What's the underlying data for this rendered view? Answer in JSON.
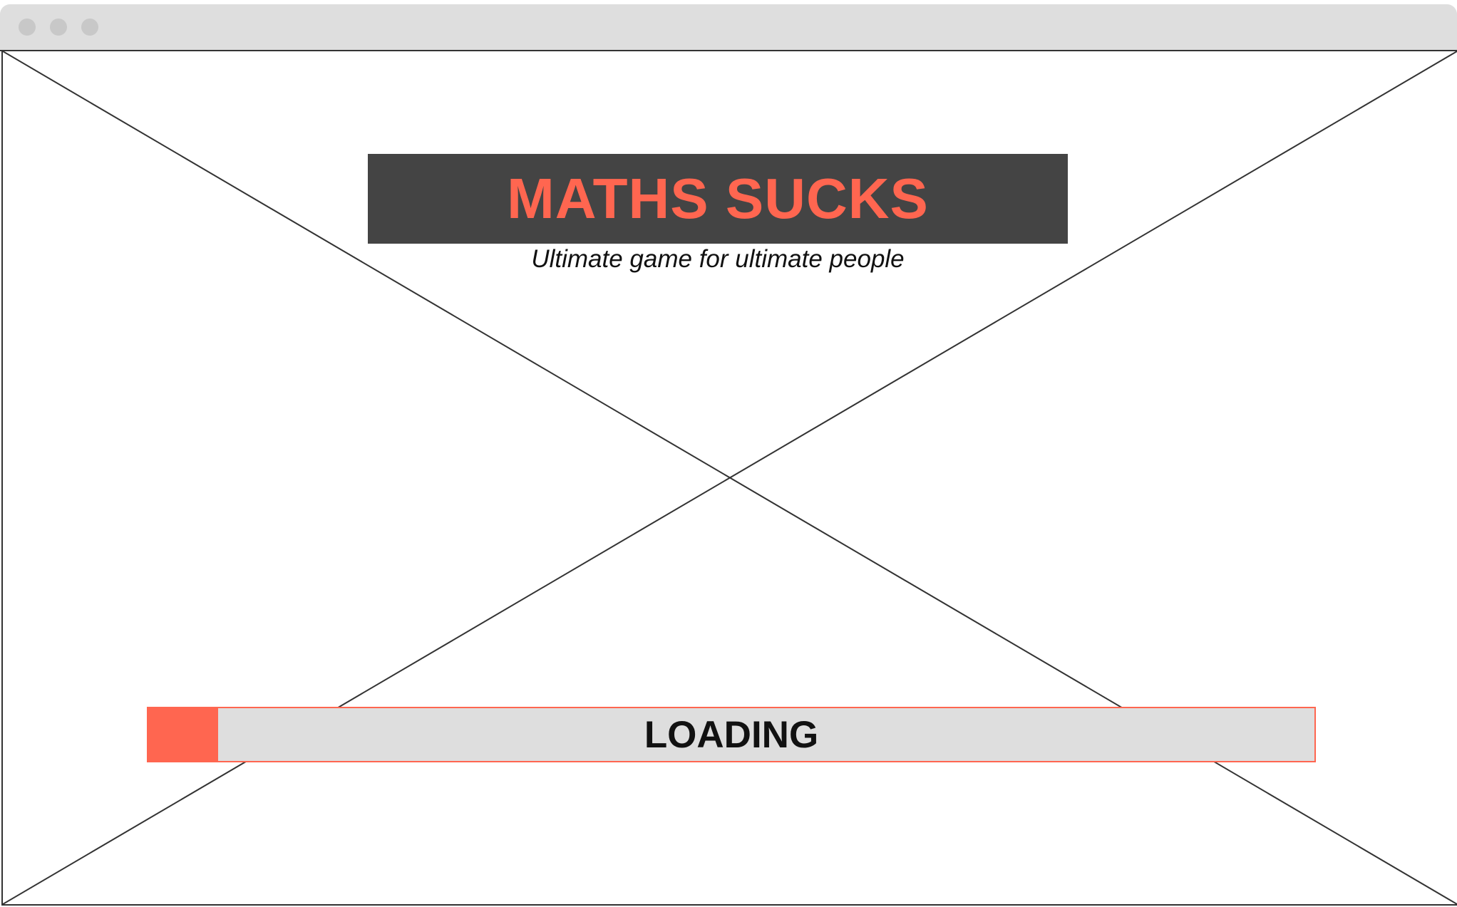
{
  "window": {
    "controls": [
      "close",
      "minimize",
      "maximize"
    ]
  },
  "game": {
    "title": "MATHS SUCKS",
    "subtitle": "Ultimate game for ultimate people"
  },
  "loading": {
    "label": "LOADING",
    "progress_percent": 6
  },
  "colors": {
    "accent": "#ff6650",
    "banner_bg": "#444444",
    "bar_bg": "#dedede",
    "titlebar_bg": "#dedede"
  }
}
